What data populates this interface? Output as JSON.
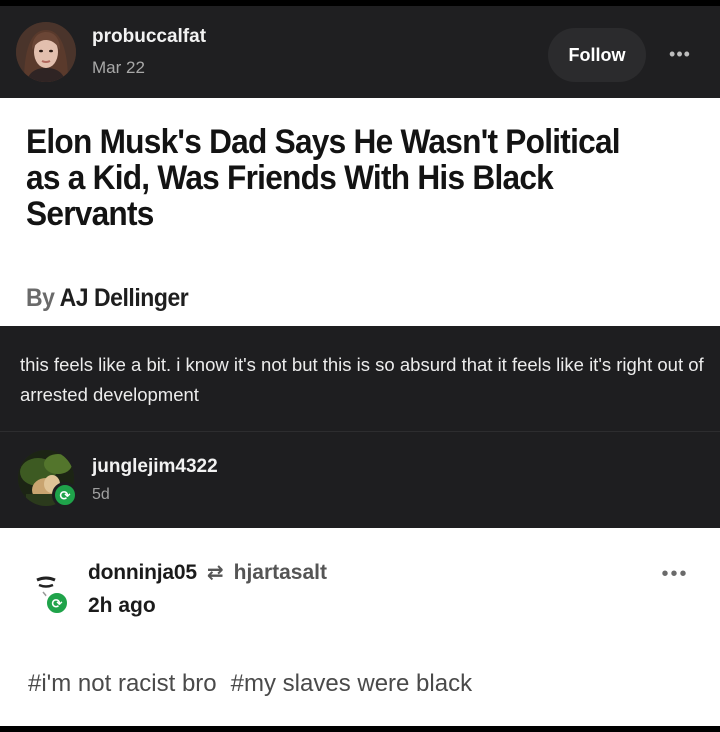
{
  "original_post": {
    "username": "probuccalfat",
    "date": "Mar 22",
    "follow_label": "Follow",
    "more_icon": "more-horizontal-icon"
  },
  "article": {
    "headline": "Elon Musk's Dad Says He Wasn't Political as a Kid, Was Friends With His Black Servants",
    "byline_prefix": "By",
    "author": "AJ Dellinger"
  },
  "comment": {
    "text": "this feels like a bit. i know it's not but this is so absurd that it feels like it's right out of arrested development"
  },
  "reblogger": {
    "username": "junglejim4322",
    "time": "5d",
    "badge_icon": "reblog-icon"
  },
  "reblog": {
    "username": "donninja05",
    "source": "hjartasalt",
    "time": "2h ago",
    "reblog_icon": "reblog-icon",
    "more_icon": "more-horizontal-icon",
    "tags": [
      "#i'm not racist bro",
      "#my slaves were black"
    ]
  },
  "colors": {
    "header_dark": "#1f1f21",
    "reblog_green": "#1fa34a",
    "text_dark": "#131313"
  }
}
